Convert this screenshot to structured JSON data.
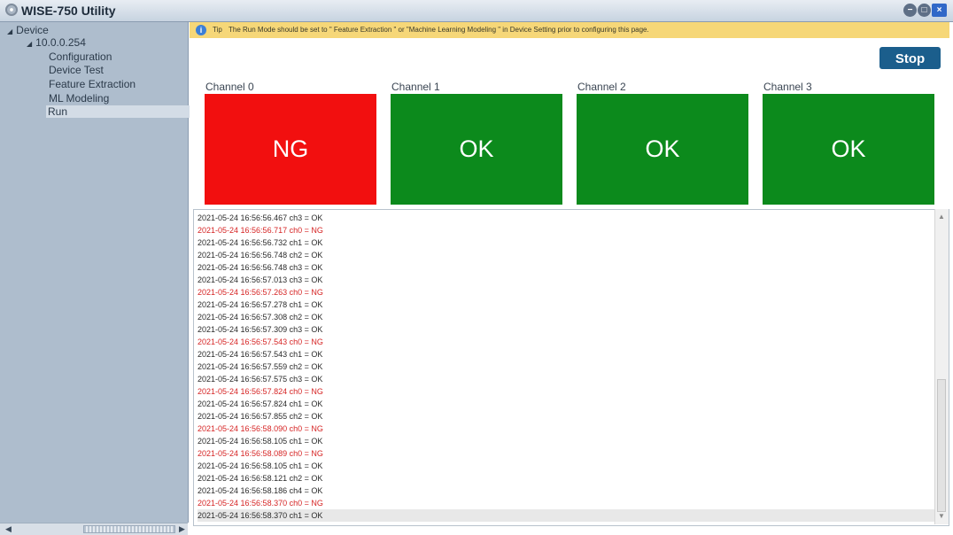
{
  "window": {
    "title": "WISE-750 Utility",
    "minimize": "−",
    "maximize": "□",
    "close": "×"
  },
  "sidebar": {
    "items": [
      {
        "label": "Device",
        "expanded": true
      },
      {
        "label": "10.0.0.254",
        "expanded": true
      },
      {
        "label": "Configuration"
      },
      {
        "label": "Device Test"
      },
      {
        "label": "Feature Extraction"
      },
      {
        "label": "ML Modeling"
      },
      {
        "label": "Run",
        "selected": true
      }
    ]
  },
  "tip": {
    "label": "Tip",
    "text": "The Run Mode should be set to \" Feature Extraction \" or \"Machine Learning Modeling \" in Device Setting prior to configuring this page."
  },
  "stop_label": "Stop",
  "channels": [
    {
      "label": "Channel 0",
      "status": "NG",
      "color": "#f20f0f"
    },
    {
      "label": "Channel 1",
      "status": "OK",
      "color": "#0c8a1c"
    },
    {
      "label": "Channel 2",
      "status": "OK",
      "color": "#0c8a1c"
    },
    {
      "label": "Channel 3",
      "status": "OK",
      "color": "#0c8a1c"
    }
  ],
  "log": [
    {
      "text": "2021-05-24 16:56:56.467 ch3 = OK",
      "status": "OK"
    },
    {
      "text": "2021-05-24 16:56:56.717 ch0 = NG",
      "status": "NG"
    },
    {
      "text": "2021-05-24 16:56:56.732 ch1 = OK",
      "status": "OK"
    },
    {
      "text": "2021-05-24 16:56:56.748 ch2 = OK",
      "status": "OK"
    },
    {
      "text": "2021-05-24 16:56:56.748 ch3 = OK",
      "status": "OK"
    },
    {
      "text": "2021-05-24 16:56:57.013 ch3 = OK",
      "status": "OK"
    },
    {
      "text": "2021-05-24 16:56:57.263 ch0 = NG",
      "status": "NG"
    },
    {
      "text": "2021-05-24 16:56:57.278 ch1 = OK",
      "status": "OK"
    },
    {
      "text": "2021-05-24 16:56:57.308 ch2 = OK",
      "status": "OK"
    },
    {
      "text": "2021-05-24 16:56:57.309 ch3 = OK",
      "status": "OK"
    },
    {
      "text": "2021-05-24 16:56:57.543 ch0 = NG",
      "status": "NG"
    },
    {
      "text": "2021-05-24 16:56:57.543 ch1 = OK",
      "status": "OK"
    },
    {
      "text": "2021-05-24 16:56:57.559 ch2 = OK",
      "status": "OK"
    },
    {
      "text": "2021-05-24 16:56:57.575 ch3 = OK",
      "status": "OK"
    },
    {
      "text": "2021-05-24 16:56:57.824 ch0 = NG",
      "status": "NG"
    },
    {
      "text": "2021-05-24 16:56:57.824 ch1 = OK",
      "status": "OK"
    },
    {
      "text": "2021-05-24 16:56:57.855 ch2 = OK",
      "status": "OK"
    },
    {
      "text": "2021-05-24 16:56:58.090 ch0 = NG",
      "status": "NG"
    },
    {
      "text": "2021-05-24 16:56:58.105 ch1 = OK",
      "status": "OK"
    },
    {
      "text": "2021-05-24 16:56:58.089 ch0 = NG",
      "status": "NG"
    },
    {
      "text": "2021-05-24 16:56:58.105 ch1 = OK",
      "status": "OK"
    },
    {
      "text": "2021-05-24 16:56:58.121 ch2 = OK",
      "status": "OK"
    },
    {
      "text": "2021-05-24 16:56:58.186 ch4 = OK",
      "status": "OK"
    },
    {
      "text": "2021-05-24 16:56:58.370 ch0 = NG",
      "status": "NG"
    },
    {
      "text": "2021-05-24 16:56:58.370 ch1 = OK",
      "status": "OK"
    }
  ],
  "colors": {
    "ng": "#f20f0f",
    "ok": "#0c8a1c",
    "stop": "#1b5e8c",
    "tip": "#f6d778",
    "sidebar": "#aebdcd"
  },
  "icons": {
    "app": "app-logo-icon",
    "info": "info-icon"
  }
}
